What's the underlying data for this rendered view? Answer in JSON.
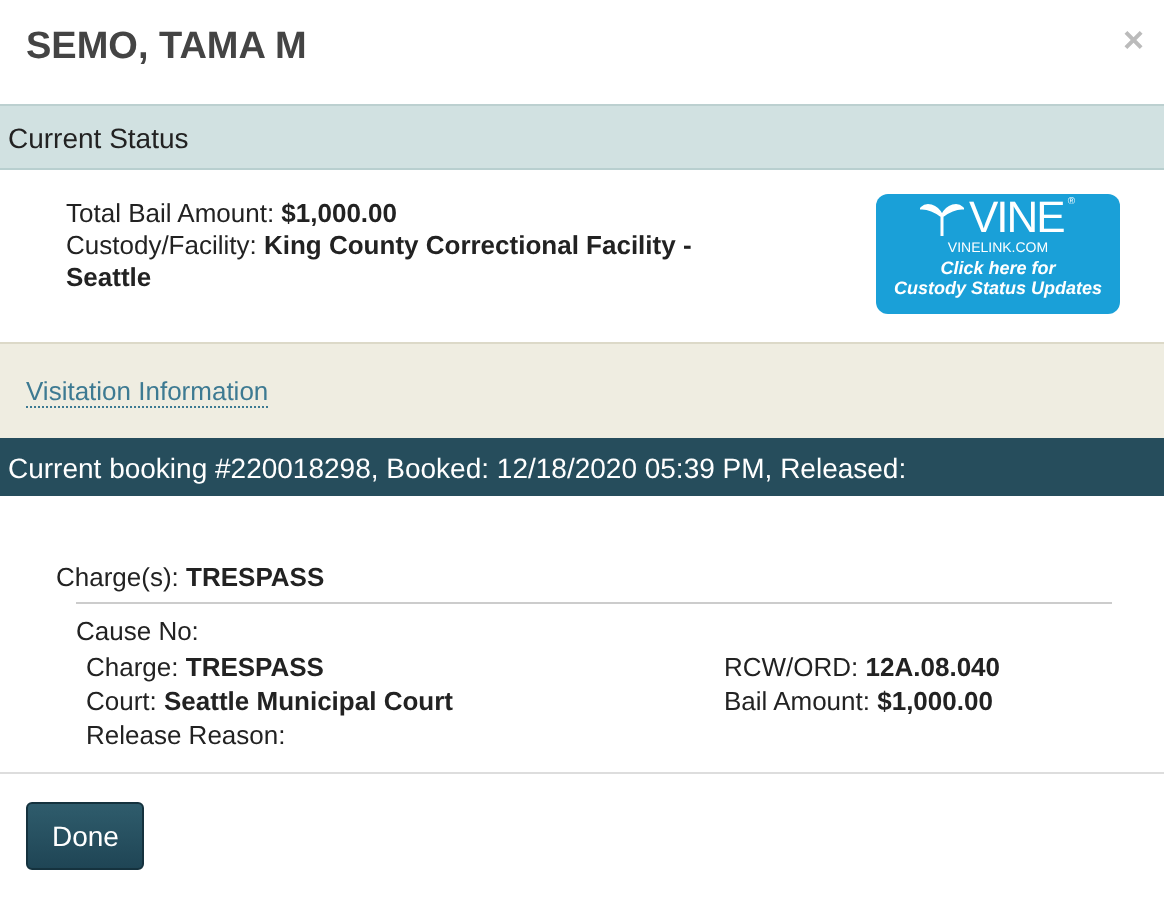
{
  "dialog": {
    "title": "SEMO, TAMA M",
    "close": "×"
  },
  "current_status": {
    "heading": "Current Status",
    "lines": [
      "Total Bail Amount: **$1,000.00**",
      "Custody/Facility: **King County Correctional Facility - Seattle**"
    ],
    "vine_logo": {
      "name": "VINE",
      "mark": "®",
      "site": "VINELINK.COM",
      "caption_1": "Click here for",
      "caption_2": "Custody Status Updates"
    }
  },
  "visitation_link": "Visitation Information",
  "booking": {
    "heading": "Current booking #220018298, Booked: 12/18/2020 05:39 PM, Released:",
    "charges": "Charge(s): **TRESPASS**",
    "cause_no": "Cause No:",
    "left": [
      "Charge: **TRESPASS**",
      "Court: **Seattle Municipal Court**",
      "Release Reason:"
    ],
    "right": [
      "RCW/ORD: **12A.08.040**",
      "Bail Amount: **$1,000.00**"
    ]
  },
  "buttons": [
    "Done"
  ]
}
